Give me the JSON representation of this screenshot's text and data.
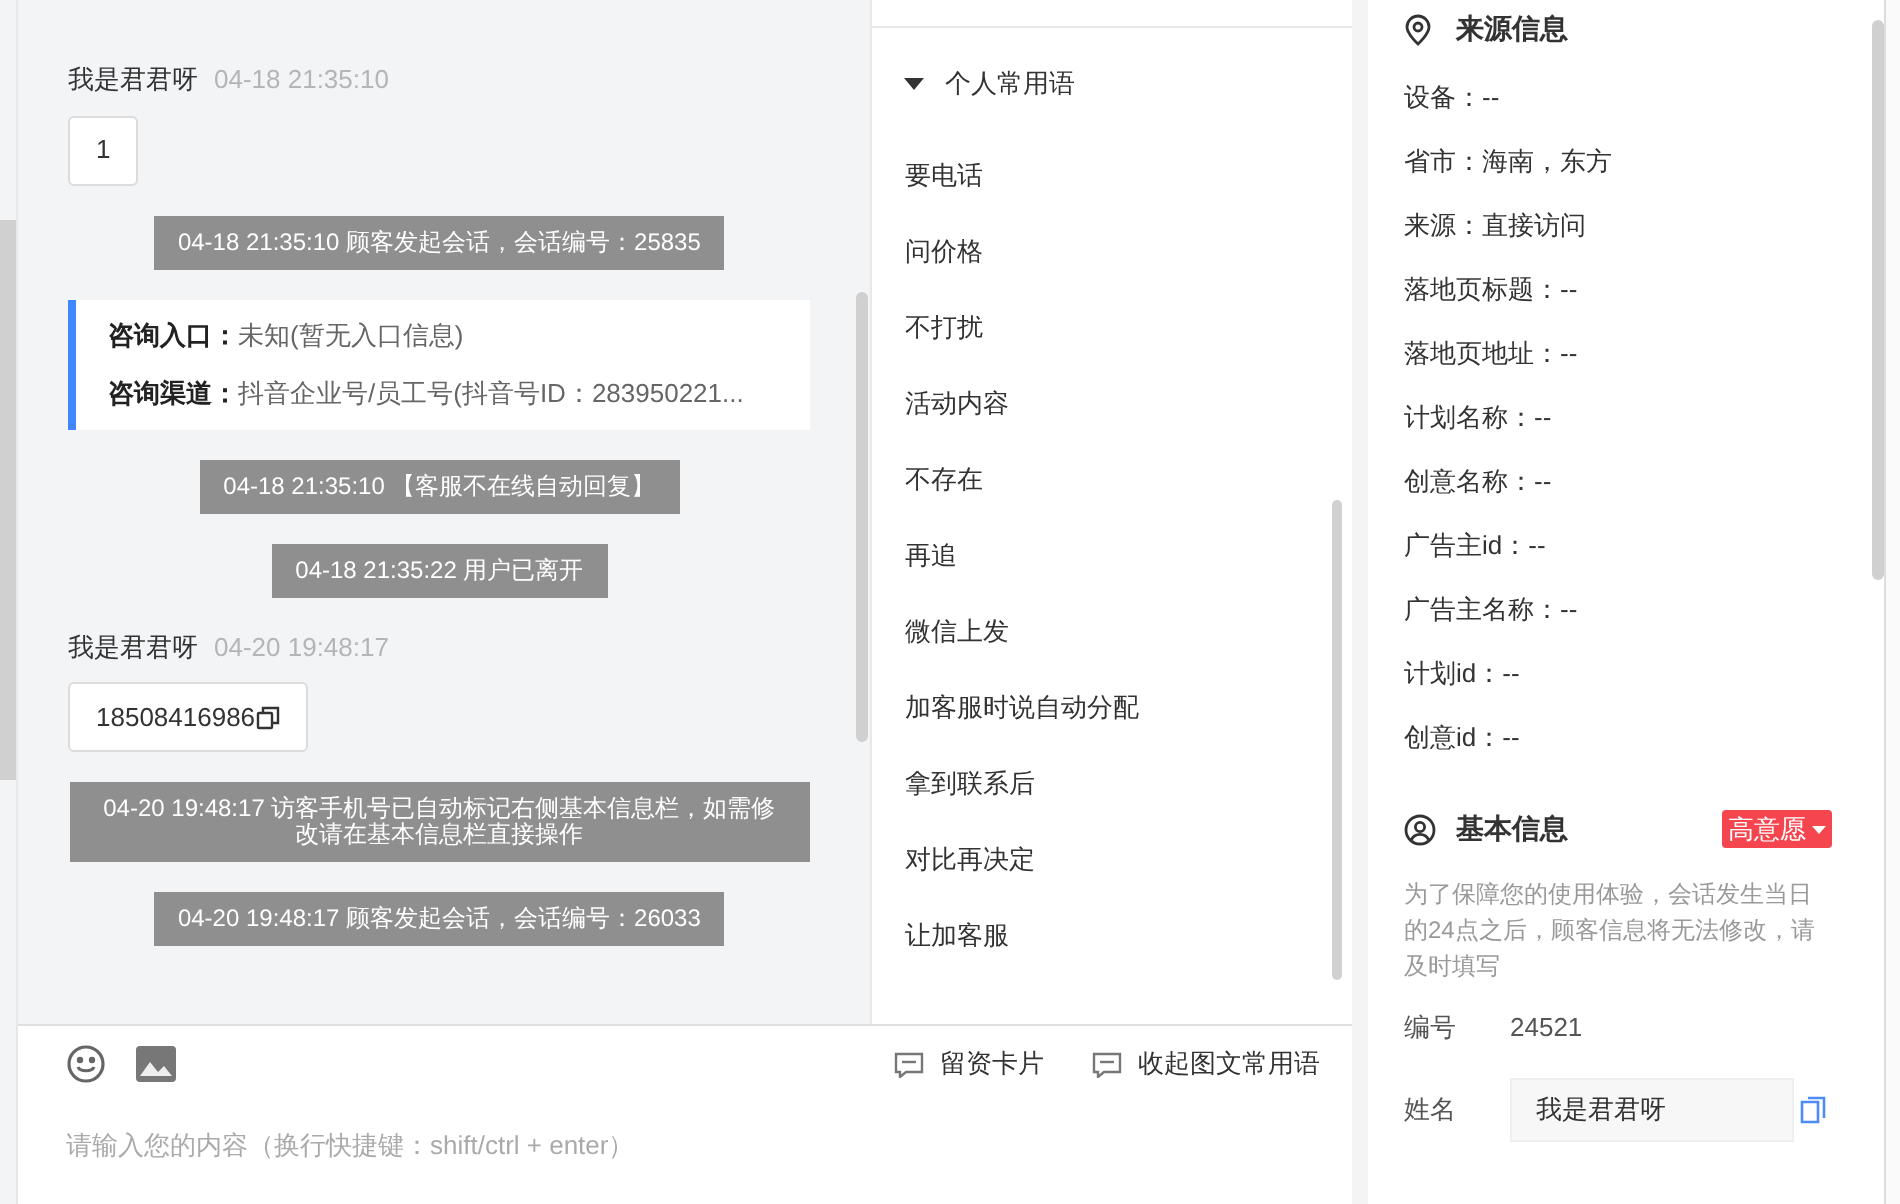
{
  "chat": {
    "messages": [
      {
        "kind": "user",
        "name": "我是君君呀",
        "time": "04-18 21:35:10",
        "text": "1",
        "copyable": false
      },
      {
        "kind": "system",
        "text": "04-18 21:35:10 顾客发起会话，会话编号：25835"
      },
      {
        "kind": "entry",
        "rows": [
          {
            "label": "咨询入口：",
            "value": "未知(暂无入口信息)"
          },
          {
            "label": "咨询渠道：",
            "value": "抖音企业号/员工号(抖音号ID：283950221..."
          }
        ]
      },
      {
        "kind": "system",
        "text": "04-18 21:35:10 【客服不在线自动回复】"
      },
      {
        "kind": "system",
        "text": "04-18 21:35:22 用户已离开"
      },
      {
        "kind": "user",
        "name": "我是君君呀",
        "time": "04-20 19:48:17",
        "text": "18508416986",
        "copyable": true
      },
      {
        "kind": "system",
        "text": "04-20 19:48:17 访客手机号已自动标记右侧基本信息栏，如需修改请在基本信息栏直接操作"
      },
      {
        "kind": "system",
        "text": "04-20 19:48:17 顾客发起会话，会话编号：26033"
      }
    ]
  },
  "composer": {
    "placeholder": "请输入您的内容（换行快捷键：shift/ctrl + enter）",
    "actions": [
      "留资卡片",
      "收起图文常用语"
    ]
  },
  "phrases": {
    "group": "个人常用语",
    "expanded": true,
    "items": [
      "要电话",
      "问价格",
      "不打扰",
      "活动内容",
      "不存在",
      "再追",
      "微信上发",
      "加客服时说自动分配",
      "拿到联系后",
      "对比再决定",
      "让加客服"
    ]
  },
  "source": {
    "title": "来源信息",
    "fields": [
      "设备：--",
      "省市：海南，东方",
      "来源：直接访问",
      "落地页标题：--",
      "落地页地址：--",
      "计划名称：--",
      "创意名称：--",
      "广告主id：--",
      "广告主名称：--",
      "计划id：--",
      "创意id：--"
    ]
  },
  "basic": {
    "title": "基本信息",
    "tag": "高意愿",
    "notice": "为了保障您的使用体验，会话发生当日的24点之后，顾客信息将无法修改，请及时填写",
    "id_label": "编号",
    "id": "24521",
    "name_label": "姓名",
    "name_value": "我是君君呀"
  }
}
